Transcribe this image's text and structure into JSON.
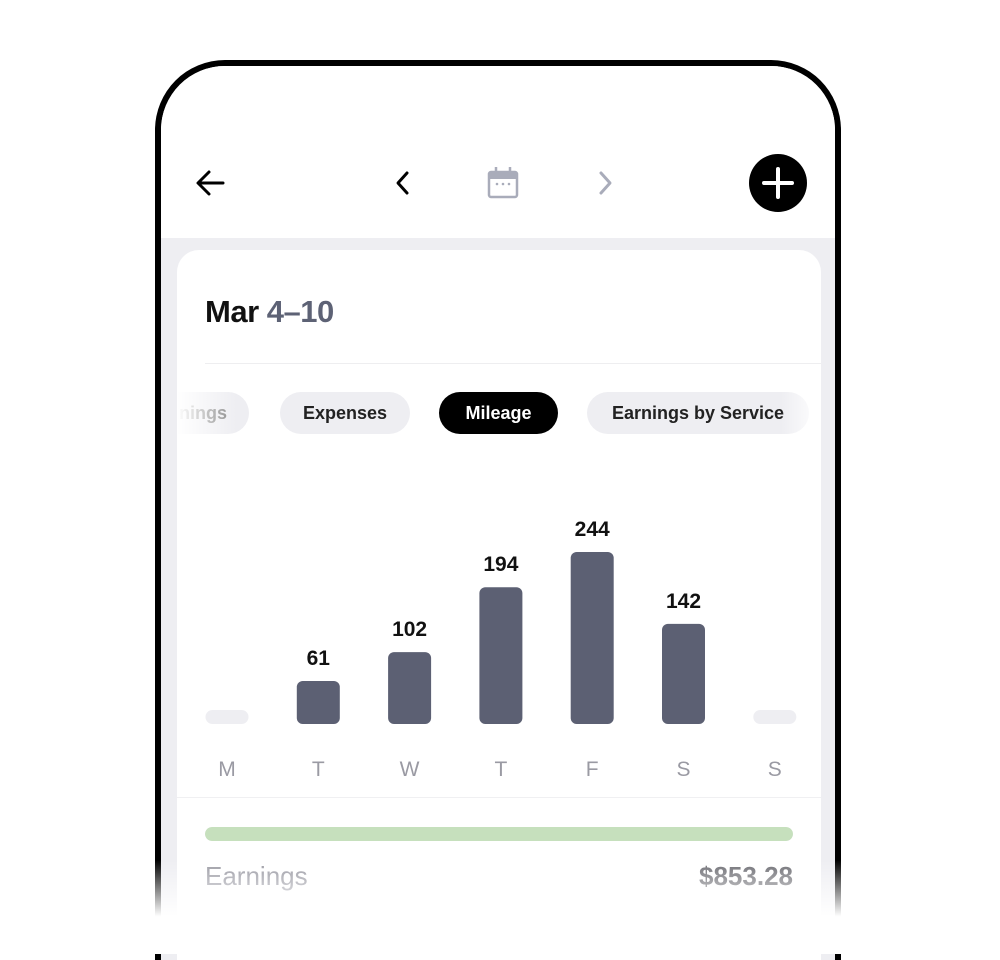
{
  "header": {
    "back_icon": "arrow-left-icon",
    "prev_icon": "chevron-left-icon",
    "calendar_icon": "calendar-icon",
    "next_icon": "chevron-right-icon",
    "add_icon": "plus-icon"
  },
  "period": {
    "month": "Mar",
    "range": "4–10"
  },
  "tabs": [
    {
      "label": "nings",
      "full_label": "Earnings",
      "active": false
    },
    {
      "label": "Expenses",
      "active": false
    },
    {
      "label": "Mileage",
      "active": true
    },
    {
      "label": "Earnings by Service",
      "active": false
    }
  ],
  "colors": {
    "bar": "#5c6073",
    "bar_empty": "#eeeef2",
    "progress": "#c6e0bd",
    "label": "#9a9aa3"
  },
  "chart_data": {
    "type": "bar",
    "title": "Mileage",
    "categories": [
      "M",
      "T",
      "W",
      "T",
      "F",
      "S",
      "S"
    ],
    "values": [
      0,
      61,
      102,
      194,
      244,
      142,
      0
    ],
    "value_labels": [
      "",
      "61",
      "102",
      "194",
      "244",
      "142",
      ""
    ],
    "xlabel": "",
    "ylabel": "",
    "ylim": [
      0,
      244
    ],
    "grid": false
  },
  "summary": {
    "earnings_label": "Earnings",
    "earnings_value": "$853.28",
    "progress_fraction": 1.0
  }
}
